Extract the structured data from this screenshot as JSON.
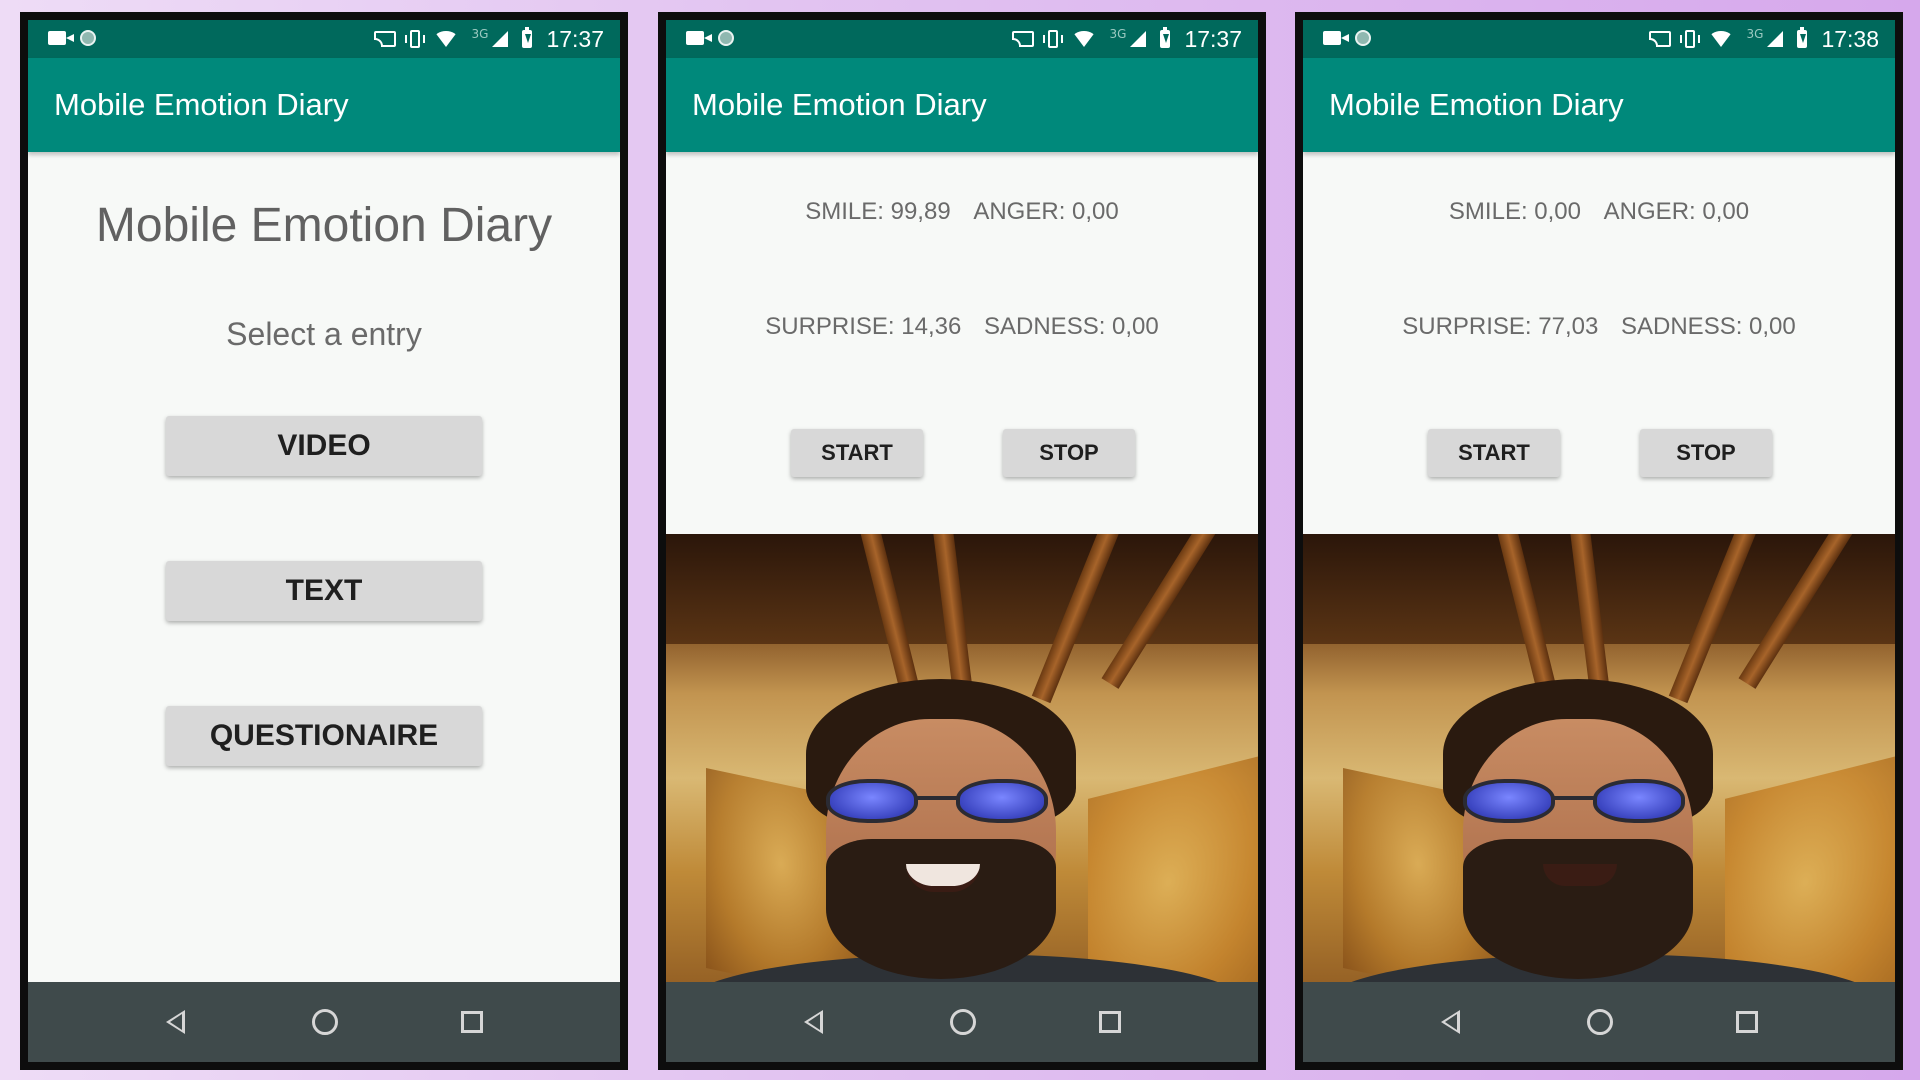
{
  "statusBar": {
    "network": "3G"
  },
  "screens": {
    "menu": {
      "time": "17:37",
      "appTitle": "Mobile Emotion Diary",
      "heading": "Mobile Emotion Diary",
      "prompt": "Select a entry",
      "buttons": {
        "video": "VIDEO",
        "text": "TEXT",
        "questionaire": "QUESTIONAIRE"
      }
    },
    "live1": {
      "time": "17:37",
      "appTitle": "Mobile Emotion Diary",
      "smile": "SMILE: 99,89",
      "anger": "ANGER: 0,00",
      "surprise": "SURPRISE: 14,36",
      "sadness": "SADNESS: 0,00",
      "startLabel": "START",
      "stopLabel": "STOP"
    },
    "live2": {
      "time": "17:38",
      "appTitle": "Mobile Emotion Diary",
      "smile": "SMILE: 0,00",
      "anger": "ANGER: 0,00",
      "surprise": "SURPRISE: 77,03",
      "sadness": "SADNESS: 0,00",
      "startLabel": "START",
      "stopLabel": "STOP"
    }
  },
  "colors": {
    "statusBar": "#00695c",
    "appBar": "#00897b",
    "navBar": "#3f4a4b",
    "background": "#e2c4f1"
  }
}
